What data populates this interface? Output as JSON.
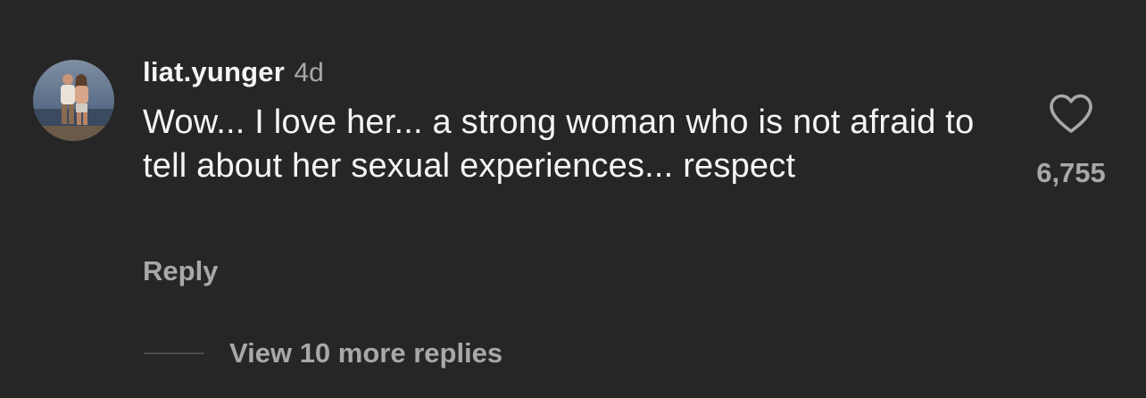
{
  "comment": {
    "username": "liat.yunger",
    "timestamp": "4d",
    "text": "Wow... I love her... a strong woman who is not afraid to tell about her sexual experiences... respect",
    "reply_label": "Reply",
    "like_count": "6,755",
    "liked": false
  },
  "replies": {
    "view_more_label": "View 10 more replies"
  },
  "colors": {
    "background": "#262626",
    "primary_text": "#f5f5f5",
    "secondary_text": "#a8a8a8",
    "divider": "#4a4a4a"
  },
  "icons": {
    "avatar": "profile-photo",
    "like": "heart-outline-icon"
  }
}
